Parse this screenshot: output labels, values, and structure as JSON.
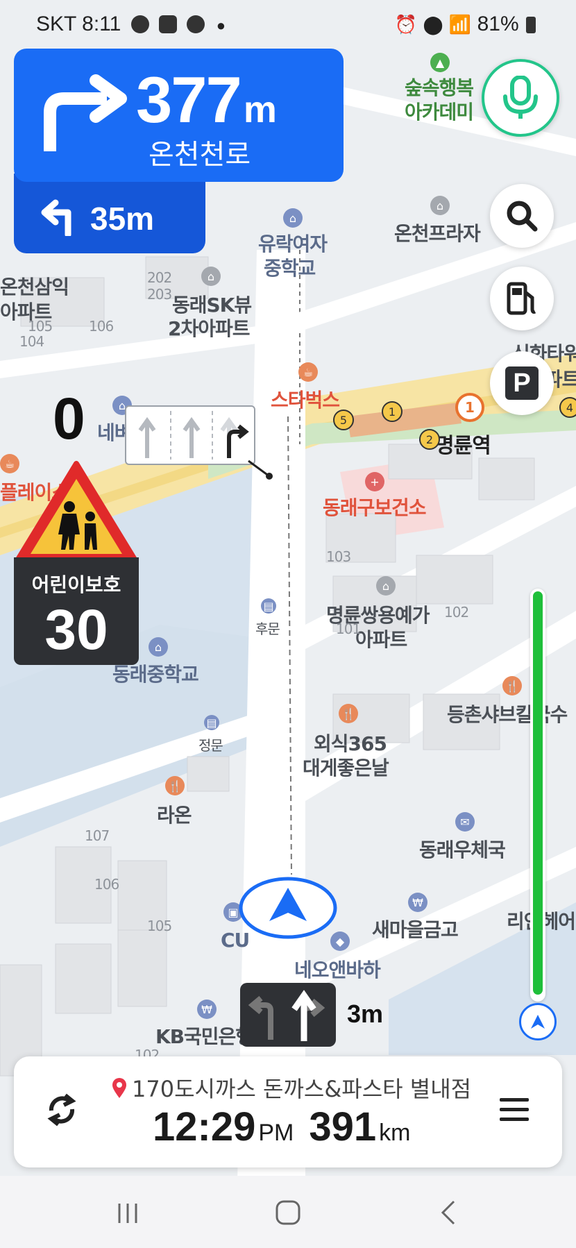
{
  "status_bar": {
    "carrier": "SKT",
    "time": "8:11",
    "battery": "81%"
  },
  "guidance": {
    "main_distance": "377",
    "main_unit": "m",
    "main_road": "온천천로",
    "next_distance": "35m",
    "lane_distance": "3m"
  },
  "speed": {
    "current": "0",
    "zone_label": "어린이보호",
    "limit": "30"
  },
  "map_labels": {
    "academy": "숲속행복",
    "academy2": "아카데미",
    "school1": "유락여자",
    "school2": "중학교",
    "plaza": "온천프라자",
    "apt1": "온천삼익",
    "apt1b": "아파트",
    "sk1": "동래SK뷰",
    "sk2": "2차아파트",
    "starbucks": "스타벅스",
    "station": "명륜역",
    "health": "동래구보건소",
    "apt2a": "명륜쌍용예가",
    "apt2b": "아파트",
    "backgate": "후문",
    "middle_school": "동래중학교",
    "maingate": "정문",
    "restaurant1": "외식365",
    "restaurant2": "대게좋은날",
    "restaurant3": "등촌샤브칼국수",
    "raon": "라온",
    "post": "동래우체국",
    "bank": "새마을금고",
    "cu": "CU",
    "neo": "네오앤바하",
    "kb": "KB국민은행",
    "ri": "리안헤어",
    "sa": "신화타워",
    "sa2": "아파트",
    "play": "플레이스",
    "ne": "네벼",
    "b202": "202",
    "b203": "203",
    "b105": "105",
    "b104": "104",
    "b106": "106",
    "b103": "103",
    "b101": "101",
    "b102": "102",
    "b107": "107",
    "b106b": "106",
    "b105b": "105",
    "b102b": "102"
  },
  "destination": {
    "name": "170도시까스 돈까스&파스타 별내점",
    "eta_time": "12:29",
    "eta_ampm": "PM",
    "distance": "391",
    "distance_unit": "km"
  },
  "progress": {
    "remaining_fraction": 0.99
  },
  "colors": {
    "primary_blue": "#1a6cf5",
    "progress_green": "#1fbf3a",
    "voice_green": "#23c58a",
    "warning_red": "#e02a2a",
    "warning_yellow": "#f6c33a"
  },
  "icons": {
    "voice": "microphone-icon",
    "search": "search-icon",
    "gas": "gas-station-icon",
    "parking": "parking-icon",
    "reroute": "reroute-icon",
    "menu": "menu-icon"
  }
}
